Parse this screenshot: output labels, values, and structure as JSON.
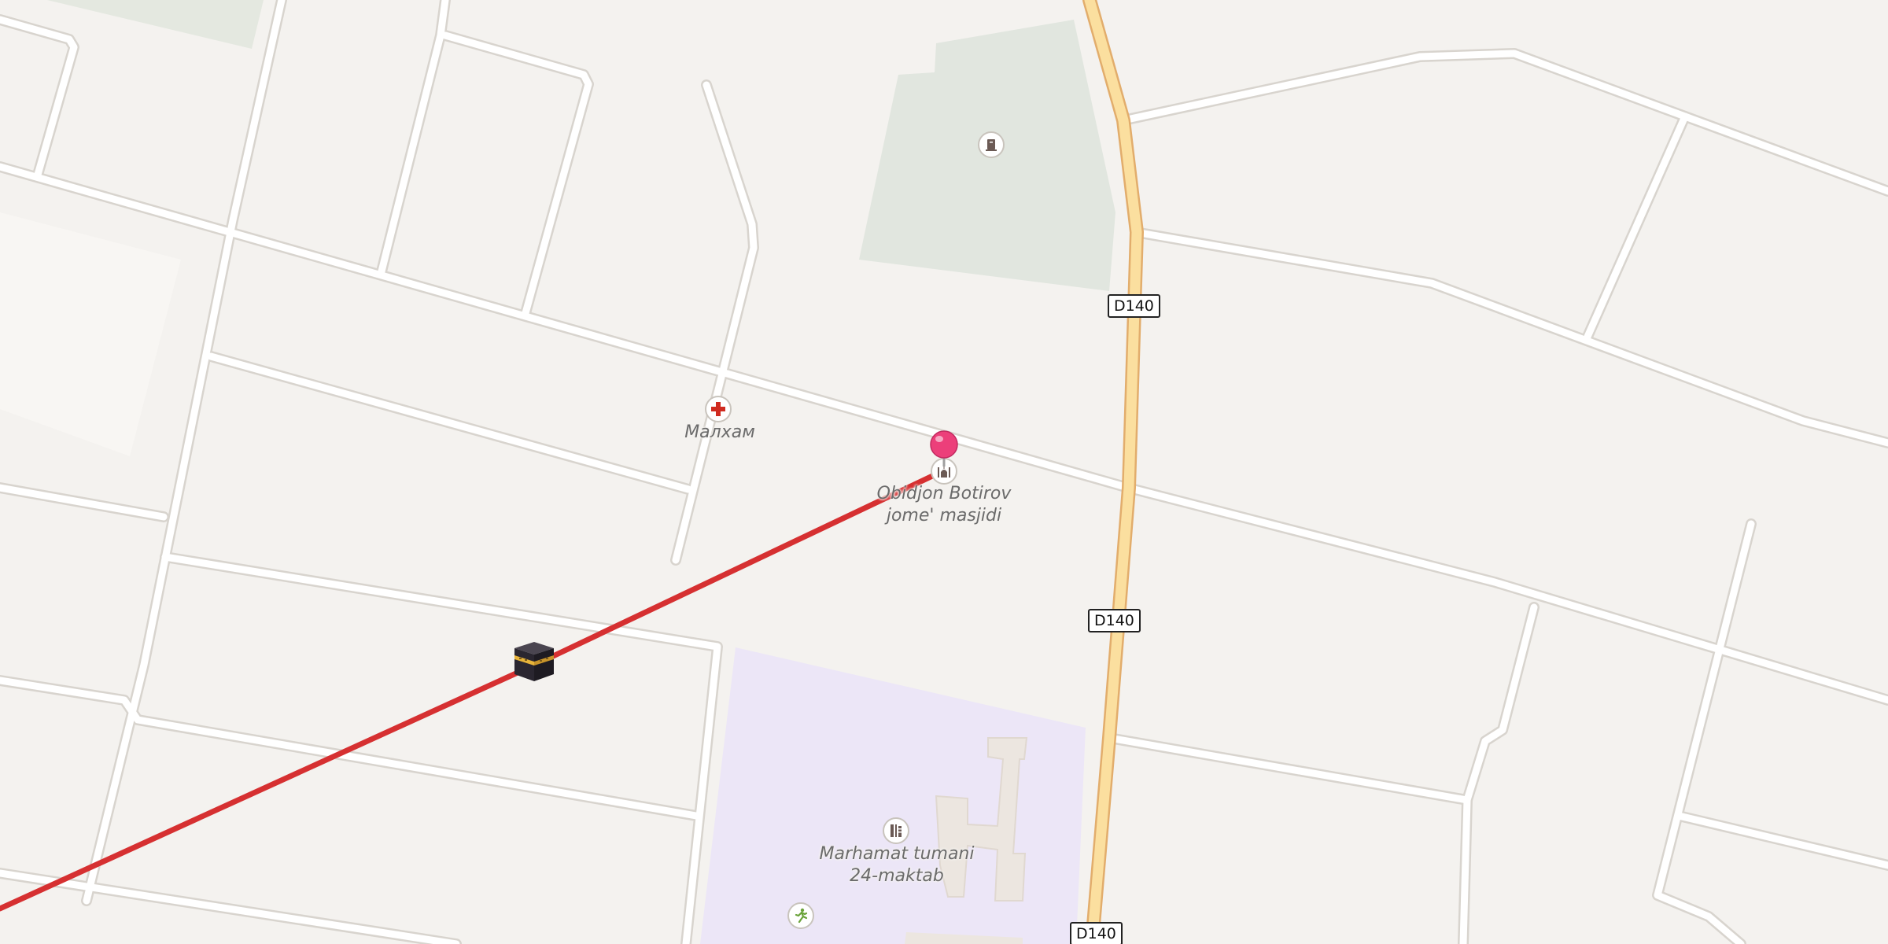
{
  "map": {
    "labels": {
      "clinic": "Малхам",
      "mosque_line1": "Obidjon Botirov",
      "mosque_line2": "jome' masjidi",
      "school_line1": "Marhamat tumani",
      "school_line2": "24-maktab"
    },
    "road_shields": [
      "D140",
      "D140",
      "D140"
    ],
    "icons": {
      "clinic": "medical-cross-icon",
      "mosque": "mosque-icon",
      "school": "school-icon",
      "sports": "running-person-icon",
      "cemetery": "tombstone-icon",
      "kaaba": "kaaba-icon",
      "pin": "location-pin-icon"
    },
    "colors": {
      "background": "#f4f2ef",
      "road": "#ffffff",
      "road_casing": "#dcd8d2",
      "primary_road": "#fbdf9f",
      "primary_road_casing": "#e2ad6c",
      "route_line": "#d63031",
      "pin": "#ec3f7a",
      "school_area": "#ece6f7",
      "cemetery_area": "#e1e6df"
    }
  }
}
